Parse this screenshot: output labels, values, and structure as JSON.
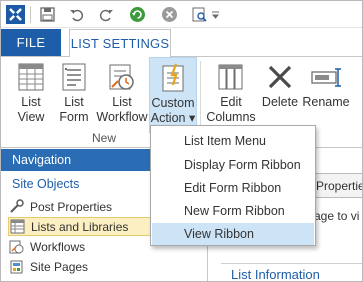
{
  "tabs": {
    "file": "FILE",
    "list_settings": "LIST SETTINGS"
  },
  "ribbon": {
    "list_view": [
      "List",
      "View"
    ],
    "list_form": [
      "List",
      "Form"
    ],
    "list_workflow": [
      "List",
      "Workflow"
    ],
    "custom_action": [
      "Custom",
      "Action ▾"
    ],
    "edit_columns": [
      "Edit",
      "Columns"
    ],
    "delete": "Delete",
    "rename": "Rename",
    "group_new": "New"
  },
  "nav": {
    "header": "Navigation",
    "section": "Site Objects",
    "items": [
      "Post Properties",
      "Lists and Libraries",
      "Workflows",
      "Site Pages"
    ]
  },
  "content": {
    "tab_label": "Properties",
    "text": "age to vi",
    "list_information": "List Information"
  },
  "menu": {
    "items": [
      "List Item Menu",
      "Display Form Ribbon",
      "Edit Form Ribbon",
      "New Form Ribbon",
      "View Ribbon"
    ],
    "highlighted": "View Ribbon"
  },
  "colors": {
    "accent": "#1e5ea9",
    "nav_header": "#2a6db5",
    "highlight": "#cde4f7",
    "selected_nav": "#fcf0c2"
  }
}
